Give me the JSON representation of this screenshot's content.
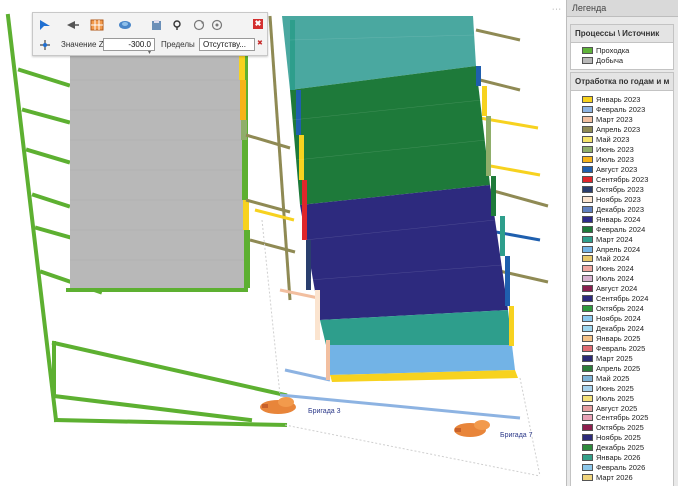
{
  "toolbar": {
    "z_label": "Значение Z",
    "z_value": "-300.0",
    "limits_label": "Пределы",
    "limits_value": "Отсутству...",
    "close": "✖"
  },
  "scene_labels": {
    "brigade_3": "Бригада 3",
    "brigade_7": "Бригада 7"
  },
  "legend": {
    "header": "Легенда",
    "processes_title": "Процессы \\ Источник",
    "processes": [
      {
        "label": "Проходка",
        "color": "#5fb33a"
      },
      {
        "label": "Добыча",
        "color": "#b9b9b9"
      }
    ],
    "months_title": "Отработка по годам и м",
    "months": [
      {
        "label": "Январь 2023",
        "color": "#f7d21f"
      },
      {
        "label": "Февраль 2023",
        "color": "#8db3e2"
      },
      {
        "label": "Март 2023",
        "color": "#f2bfa0"
      },
      {
        "label": "Апрель 2023",
        "color": "#8f8a54"
      },
      {
        "label": "Май 2023",
        "color": "#f5e46a"
      },
      {
        "label": "Июнь 2023",
        "color": "#8fae6a"
      },
      {
        "label": "Июль 2023",
        "color": "#f5b319"
      },
      {
        "label": "Август 2023",
        "color": "#1f5fae"
      },
      {
        "label": "Сентябрь 2023",
        "color": "#e0262b"
      },
      {
        "label": "Октябрь 2023",
        "color": "#2a3e6e"
      },
      {
        "label": "Ноябрь 2023",
        "color": "#fbe4cf"
      },
      {
        "label": "Декабрь 2023",
        "color": "#5f7fbf"
      },
      {
        "label": "Январь 2024",
        "color": "#2e2a8a"
      },
      {
        "label": "Февраль 2024",
        "color": "#1e7a3a"
      },
      {
        "label": "Март 2024",
        "color": "#2e9e8c"
      },
      {
        "label": "Апрель 2024",
        "color": "#72b3e6"
      },
      {
        "label": "Май 2024",
        "color": "#e8c86a"
      },
      {
        "label": "Июнь 2024",
        "color": "#f0a7a0"
      },
      {
        "label": "Июль 2024",
        "color": "#d8b2d0"
      },
      {
        "label": "Август 2024",
        "color": "#8a2050"
      },
      {
        "label": "Сентябрь 2024",
        "color": "#2d2a7e"
      },
      {
        "label": "Октябрь 2024",
        "color": "#2f9a3e"
      },
      {
        "label": "Ноябрь 2024",
        "color": "#8bc9ef"
      },
      {
        "label": "Декабрь 2024",
        "color": "#9ed7f0"
      },
      {
        "label": "Январь 2025",
        "color": "#f5c389"
      },
      {
        "label": "Февраль 2025",
        "color": "#e06c73"
      },
      {
        "label": "Март 2025",
        "color": "#2c2a76"
      },
      {
        "label": "Апрель 2025",
        "color": "#2d7d3a"
      },
      {
        "label": "Май 2025",
        "color": "#7fb4d9"
      },
      {
        "label": "Июнь 2025",
        "color": "#a7d3ee"
      },
      {
        "label": "Июль 2025",
        "color": "#f4e17a"
      },
      {
        "label": "Август 2025",
        "color": "#e59ea0"
      },
      {
        "label": "Сентябрь 2025",
        "color": "#e8a1b6"
      },
      {
        "label": "Октябрь 2025",
        "color": "#8e1f4e"
      },
      {
        "label": "Ноябрь 2025",
        "color": "#2d2b7a"
      },
      {
        "label": "Декабрь 2025",
        "color": "#2e8a3c"
      },
      {
        "label": "Январь 2026",
        "color": "#35a08a"
      },
      {
        "label": "Февраль 2026",
        "color": "#8cc7ea"
      },
      {
        "label": "Март 2026",
        "color": "#f0d47c"
      }
    ]
  }
}
